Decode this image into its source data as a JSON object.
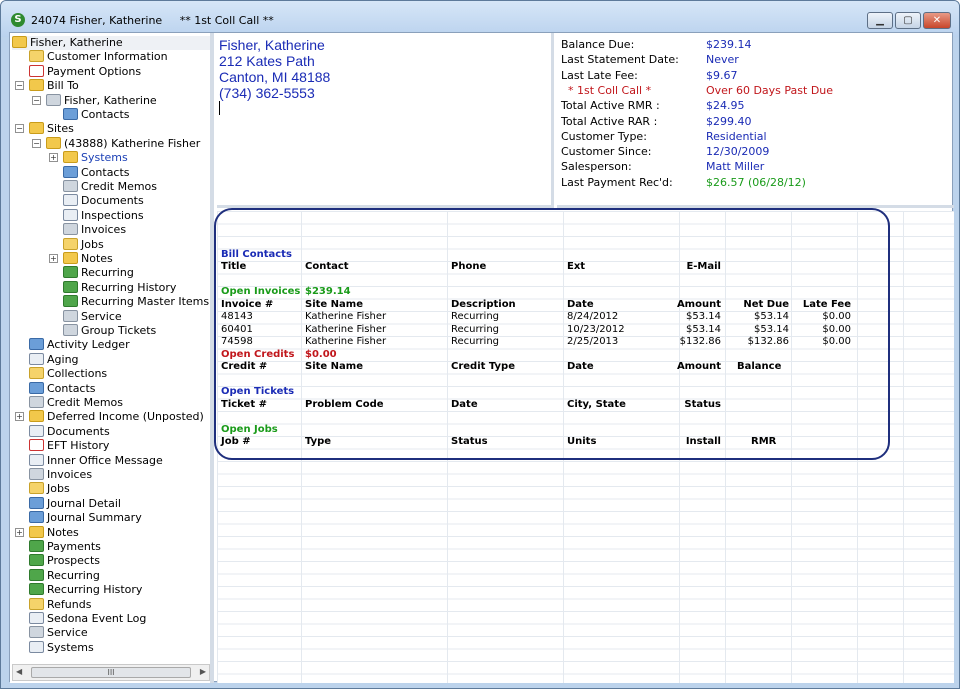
{
  "window": {
    "account_number": "24074",
    "customer_name": "Fisher, Katherine",
    "status_note": "** 1st Coll Call **",
    "app_icon": "S"
  },
  "tree": {
    "root": "Fisher, Katherine",
    "items": [
      {
        "label": "Customer Information",
        "icon": "shield-icon"
      },
      {
        "label": "Payment Options",
        "icon": "payment-icon"
      },
      {
        "label": "Bill To",
        "icon": "folder-icon"
      },
      {
        "label": "Fisher, Katherine",
        "icon": "person-icon"
      },
      {
        "label": "Contacts",
        "icon": "contacts-icon"
      },
      {
        "label": "Sites",
        "icon": "folder-icon"
      },
      {
        "label": "(43888) Katherine Fisher",
        "icon": "folder-icon"
      },
      {
        "label": "Systems",
        "icon": "folder-icon"
      },
      {
        "label": "Contacts",
        "icon": "contacts-icon"
      },
      {
        "label": "Credit Memos",
        "icon": "credit-memo-icon"
      },
      {
        "label": "Documents",
        "icon": "document-icon"
      },
      {
        "label": "Inspections",
        "icon": "inspection-icon"
      },
      {
        "label": "Invoices",
        "icon": "invoice-icon"
      },
      {
        "label": "Jobs",
        "icon": "jobs-icon"
      },
      {
        "label": "Notes",
        "icon": "folder-icon"
      },
      {
        "label": "Recurring",
        "icon": "recurring-icon"
      },
      {
        "label": "Recurring History",
        "icon": "recurring-history-icon"
      },
      {
        "label": "Recurring Master Items",
        "icon": "recurring-master-icon"
      },
      {
        "label": "Service",
        "icon": "wrench-icon"
      },
      {
        "label": "Group Tickets",
        "icon": "wrench-icon"
      },
      {
        "label": "Activity Ledger",
        "icon": "ledger-icon"
      },
      {
        "label": "Aging",
        "icon": "aging-icon"
      },
      {
        "label": "Collections",
        "icon": "collections-icon"
      },
      {
        "label": "Contacts",
        "icon": "contacts-icon"
      },
      {
        "label": "Credit Memos",
        "icon": "credit-memo-icon"
      },
      {
        "label": "Deferred Income (Unposted)",
        "icon": "folder-icon"
      },
      {
        "label": "Documents",
        "icon": "document-icon"
      },
      {
        "label": "EFT History",
        "icon": "eft-icon"
      },
      {
        "label": "Inner Office Message",
        "icon": "message-icon"
      },
      {
        "label": "Invoices",
        "icon": "invoice-icon"
      },
      {
        "label": "Jobs",
        "icon": "jobs-icon"
      },
      {
        "label": "Journal Detail",
        "icon": "journal-icon"
      },
      {
        "label": "Journal Summary",
        "icon": "journal-icon"
      },
      {
        "label": "Notes",
        "icon": "folder-icon"
      },
      {
        "label": "Payments",
        "icon": "payments-icon"
      },
      {
        "label": "Prospects",
        "icon": "prospects-icon"
      },
      {
        "label": "Recurring",
        "icon": "recurring-icon"
      },
      {
        "label": "Recurring History",
        "icon": "recurring-history-icon"
      },
      {
        "label": "Refunds",
        "icon": "refunds-icon"
      },
      {
        "label": "Sedona Event Log",
        "icon": "event-log-icon"
      },
      {
        "label": "Service",
        "icon": "wrench-icon"
      },
      {
        "label": "Systems",
        "icon": "systems-icon"
      }
    ],
    "scroll_thumb": "III"
  },
  "address": {
    "name": "Fisher, Katherine",
    "street": "212  Kates Path",
    "city": "Canton, MI  48188",
    "phone": "(734) 362-5553"
  },
  "summary": [
    {
      "label": "Balance Due:",
      "value": "$239.14"
    },
    {
      "label": "Last Statement Date:",
      "value": "Never"
    },
    {
      "label": "Last Late Fee:",
      "value": "$9.67"
    },
    {
      "label": "  * 1st Coll Call *",
      "value": "Over 60 Days Past Due"
    },
    {
      "label": "Total Active RMR :",
      "value": "$24.95"
    },
    {
      "label": "Total Active RAR :",
      "value": "$299.40"
    },
    {
      "label": "Customer Type:",
      "value": "Residential"
    },
    {
      "label": "Customer Since:",
      "value": "12/30/2009"
    },
    {
      "label": "Salesperson:",
      "value": "Matt Miller"
    },
    {
      "label": "Last Payment Rec'd:",
      "value": "$26.57 (06/28/12)"
    }
  ],
  "bill_contacts": {
    "title": "Bill Contacts",
    "headers": [
      "Title",
      "Contact",
      "Phone",
      "Ext",
      "E-Mail"
    ]
  },
  "open_invoices": {
    "title": "Open Invoices",
    "total": "$239.14",
    "headers": [
      "Invoice #",
      "Site Name",
      "Description",
      "Date",
      "Amount",
      "Net Due",
      "Late Fee"
    ],
    "rows": [
      [
        "48143",
        "Katherine Fisher",
        "Recurring",
        "8/24/2012",
        "$53.14",
        "$53.14",
        "$0.00"
      ],
      [
        "60401",
        "Katherine Fisher",
        "Recurring",
        "10/23/2012",
        "$53.14",
        "$53.14",
        "$0.00"
      ],
      [
        "74598",
        "Katherine Fisher",
        "Recurring",
        "2/25/2013",
        "$132.86",
        "$132.86",
        "$0.00"
      ]
    ]
  },
  "open_credits": {
    "title": "Open Credits",
    "total": "$0.00",
    "headers": [
      "Credit #",
      "Site Name",
      "Credit Type",
      "Date",
      "Amount",
      "Balance"
    ]
  },
  "open_tickets": {
    "title": "Open Tickets",
    "headers": [
      "Ticket #",
      "Problem Code",
      "Date",
      "City, State",
      "Status"
    ]
  },
  "open_jobs": {
    "title": "Open Jobs",
    "headers": [
      "Job #",
      "Type",
      "Status",
      "Units",
      "Install",
      "RMR"
    ]
  }
}
